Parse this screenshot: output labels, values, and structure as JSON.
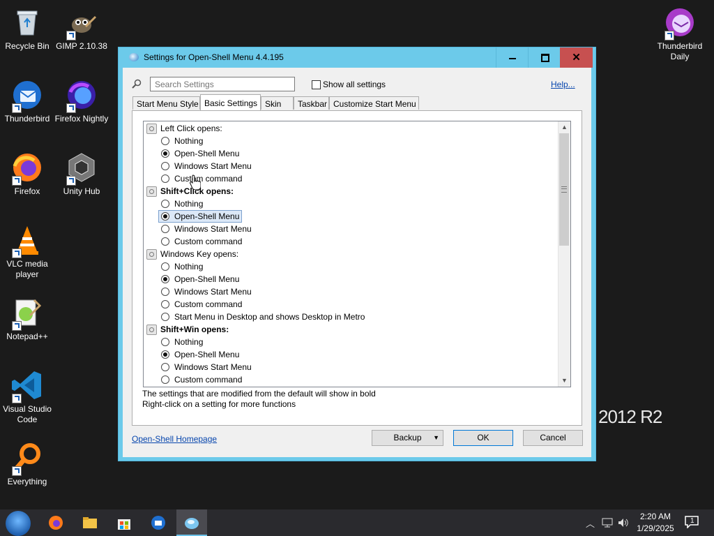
{
  "desktop": {
    "icons": [
      {
        "label": "Recycle Bin",
        "icon": "recycle-bin-icon"
      },
      {
        "label": "GIMP 2.10.38",
        "icon": "gimp-icon"
      },
      {
        "label": "Thunderbird Daily",
        "icon": "thunderbird-daily-icon"
      },
      {
        "label": "Thunderbird",
        "icon": "thunderbird-icon"
      },
      {
        "label": "Firefox Nightly",
        "icon": "firefox-nightly-icon"
      },
      {
        "label": "Firefox",
        "icon": "firefox-icon"
      },
      {
        "label": "Unity Hub",
        "icon": "unity-hub-icon"
      },
      {
        "label": "VLC media player",
        "icon": "vlc-icon"
      },
      {
        "label": "Notepad++",
        "icon": "notepadpp-icon"
      },
      {
        "label": "Visual Studio Code",
        "icon": "vscode-icon"
      },
      {
        "label": "Everything",
        "icon": "everything-icon"
      }
    ],
    "watermark": "2012 R2"
  },
  "window": {
    "title": "Settings for Open-Shell Menu 4.4.195",
    "close_glyph": "✕",
    "search_placeholder": "Search Settings",
    "show_all_label": "Show all settings",
    "help_link": "Help...",
    "tabs": [
      "Start Menu Style",
      "Basic Settings",
      "Skin",
      "Taskbar",
      "Customize Start Menu"
    ],
    "active_tab": "Basic Settings",
    "groups": [
      {
        "label": "Left Click opens:",
        "bold": false,
        "options": [
          "Nothing",
          "Open-Shell Menu",
          "Windows Start Menu",
          "Custom command"
        ],
        "selected": 1
      },
      {
        "label": "Shift+Click opens:",
        "bold": true,
        "options": [
          "Nothing",
          "Open-Shell Menu",
          "Windows Start Menu",
          "Custom command"
        ],
        "selected": 1
      },
      {
        "label": "Windows Key opens:",
        "bold": false,
        "options": [
          "Nothing",
          "Open-Shell Menu",
          "Windows Start Menu",
          "Custom command",
          "Start Menu in Desktop and shows Desktop in Metro"
        ],
        "selected": 1
      },
      {
        "label": "Shift+Win opens:",
        "bold": true,
        "options": [
          "Nothing",
          "Open-Shell Menu",
          "Windows Start Menu",
          "Custom command"
        ],
        "selected": 1
      }
    ],
    "note_line1": "The settings that are modified from the default will show in bold",
    "note_line2": "Right-click on a setting for more functions",
    "homepage_link": "Open-Shell Homepage",
    "backup_label": "Backup",
    "ok_label": "OK",
    "cancel_label": "Cancel"
  },
  "taskbar": {
    "pinned": [
      "start-orb-icon",
      "firefox-icon",
      "file-explorer-icon",
      "store-icon",
      "thunderbird-icon",
      "open-shell-settings-icon"
    ],
    "clock_time": "2:20 AM",
    "clock_date": "1/29/2025",
    "notification_count": "1"
  }
}
